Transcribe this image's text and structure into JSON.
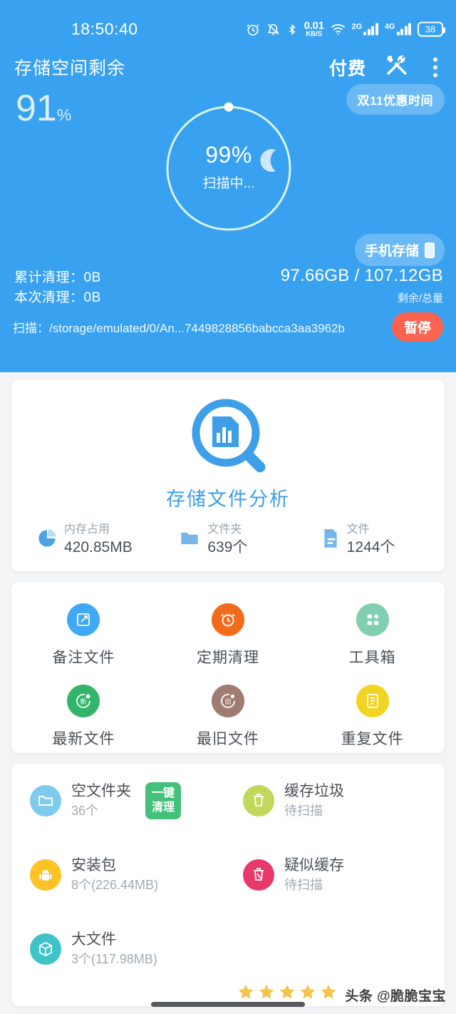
{
  "status_bar": {
    "time": "18:50:40",
    "net_speed_value": "0.01",
    "net_speed_unit": "KB/S",
    "sim1_label": "2G",
    "sim2_label": "4G",
    "battery": "38",
    "icons": [
      "alarm-icon",
      "bell-muted-icon",
      "bluetooth-icon",
      "network-speed",
      "wifi-icon",
      "signal-2g-icon",
      "signal-4g-icon",
      "battery-icon"
    ]
  },
  "header": {
    "app_title": "存储空间剩余",
    "pay_label": "付费",
    "tools_icon": "tools-icon",
    "more_icon": "more-vertical-icon",
    "free_percent": "91",
    "percent_symbol": "%",
    "promo_badge": "双11优惠时间",
    "storage_badge": "手机存储",
    "ring": {
      "percent": "99%",
      "status": "扫描中...",
      "progress": 99,
      "accent": "#d8f3e8"
    },
    "stats": {
      "total_cleaned_label": "累计清理：",
      "total_cleaned_value": "0B",
      "this_cleaned_label": "本次清理：",
      "this_cleaned_value": "0B"
    },
    "size": {
      "value": "97.66GB / 107.12GB",
      "caption": "剩余/总量"
    },
    "scan": {
      "label": "扫描：",
      "path": "/storage/emulated/0/An...7449828856babcca3aa3962b",
      "pause_label": "暂停",
      "pause_color": "#f9634f"
    },
    "bg_color": "#38a1f0"
  },
  "analysis_card": {
    "icon": "storage-analysis-magnifier-icon",
    "title": "存储文件分析",
    "title_color": "#3d9fe8",
    "stats": [
      {
        "icon": "pie-chart-icon",
        "label": "内存占用",
        "value": "420.85MB"
      },
      {
        "icon": "folder-icon",
        "label": "文件夹",
        "value": "639个"
      },
      {
        "icon": "file-icon",
        "label": "文件",
        "value": "1244个"
      }
    ]
  },
  "grid_card": {
    "items": [
      {
        "icon": "note-edit-icon",
        "label": "备注文件",
        "color": "#40a9f5"
      },
      {
        "icon": "alarm-clock-icon",
        "label": "定期清理",
        "color": "#f26a1b"
      },
      {
        "icon": "toolbox-grid-icon",
        "label": "工具箱",
        "color": "#7fcfb0"
      },
      {
        "icon": "new-file-icon",
        "label": "最新文件",
        "color": "#32b56a"
      },
      {
        "icon": "old-file-icon",
        "label": "最旧文件",
        "color": "#a07b72"
      },
      {
        "icon": "duplicate-file-icon",
        "label": "重复文件",
        "color": "#f2d522"
      }
    ]
  },
  "list_card": {
    "items": [
      {
        "icon": "empty-folder-icon",
        "color": "#7ecbee",
        "name": "空文件夹",
        "sub": "36个",
        "action": "一键\n清理",
        "action_color": "#44c07a"
      },
      {
        "icon": "trash-icon",
        "color": "#bcd champion",
        "name": "缓存垃圾",
        "sub": "待扫描"
      },
      {
        "icon": "apk-android-icon",
        "color": "#fcc326",
        "name": "安装包",
        "sub": "8个(226.44MB)"
      },
      {
        "icon": "suspected-cache-icon",
        "color": "#e8396b",
        "name": "疑似缓存",
        "sub": "待扫描"
      },
      {
        "icon": "big-file-box-icon",
        "color": "#3fc3c9",
        "name": "大文件",
        "sub": "3个(117.98MB)"
      }
    ]
  },
  "overlay": {
    "stars_count": 5,
    "star_color": "#f5c44c",
    "watermark": "头条 @脆脆宝宝",
    "home_indicator": "home-indicator"
  }
}
